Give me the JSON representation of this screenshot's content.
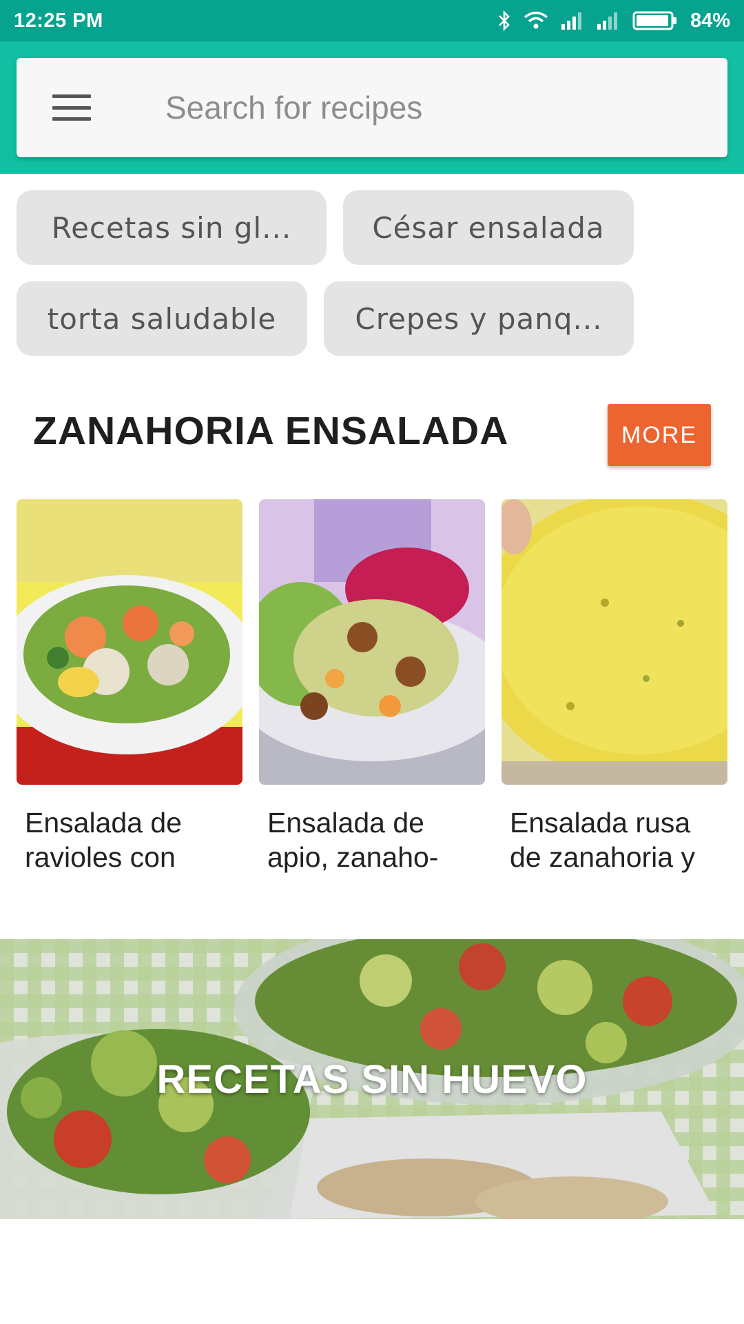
{
  "status_bar": {
    "time": "12:25 PM",
    "battery": "84%",
    "icons": [
      "bluetooth-icon",
      "wifi-icon",
      "signal-icon",
      "signal-icon",
      "battery-icon"
    ]
  },
  "search": {
    "placeholder": "Search for recipes",
    "menu_icon": "menu-icon"
  },
  "chips": [
    {
      "label": "Recetas sin gl..."
    },
    {
      "label": "César ensalada"
    },
    {
      "label": "torta saludable"
    },
    {
      "label": "Crepes y panq..."
    }
  ],
  "section": {
    "title": "ZANAHORIA ENSALADA",
    "more_label": "MORE"
  },
  "cards": [
    {
      "title": "Ensalada de ravioles con"
    },
    {
      "title": "Ensalada de apio, zanaho-"
    },
    {
      "title": "Ensalada rusa de zanahoria y"
    }
  ],
  "banner": {
    "title": "RECETAS SIN HUEVO"
  },
  "colors": {
    "status_bar": "#06a38f",
    "app_bar": "#12bfa3",
    "accent_button": "#ec6530",
    "chip_bg": "#e4e4e4"
  }
}
